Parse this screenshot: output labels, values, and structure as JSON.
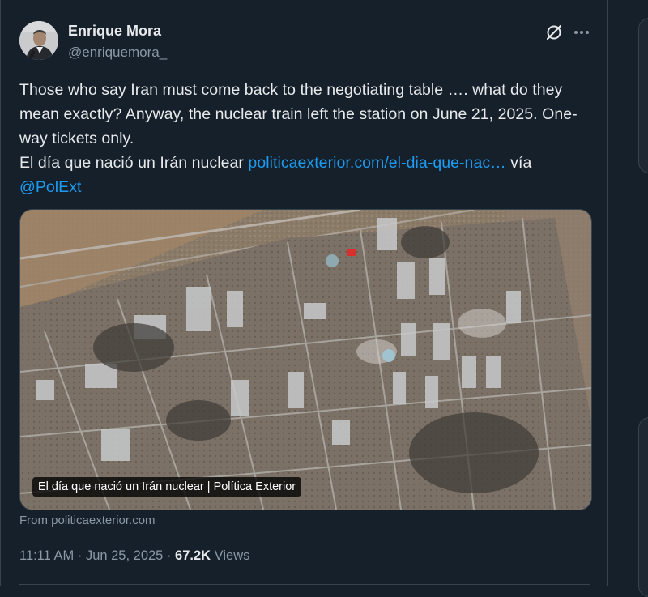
{
  "author": {
    "display_name": "Enrique Mora",
    "handle": "@enriquemora_"
  },
  "tweet": {
    "text_line1": "Those who say Iran must come back to the negotiating table …. what do they mean exactly? Anyway, the nuclear train left the station on June 21, 2025. One-way tickets only.",
    "text_line2_prefix": "El día que nació un Irán nuclear ",
    "link_text": "politicaexterior.com/el-dia-que-nac…",
    "text_line2_suffix": " vía",
    "mention": "@PolExt"
  },
  "card": {
    "caption": "El día que nació un Irán nuclear | Política Exterior",
    "source": "From politicaexterior.com"
  },
  "meta": {
    "time": "11:11 AM",
    "separator": " · ",
    "date": "Jun 25, 2025",
    "views_count": "67.2K",
    "views_label": "Views"
  },
  "icons": {
    "grok": "grok-icon",
    "more": "more-icon",
    "avatar": "avatar"
  },
  "colors": {
    "background": "#15202b",
    "link": "#1d9bf0",
    "secondary_text": "#8b98a5",
    "primary_text": "#e7e9ea",
    "border": "#38444d"
  }
}
